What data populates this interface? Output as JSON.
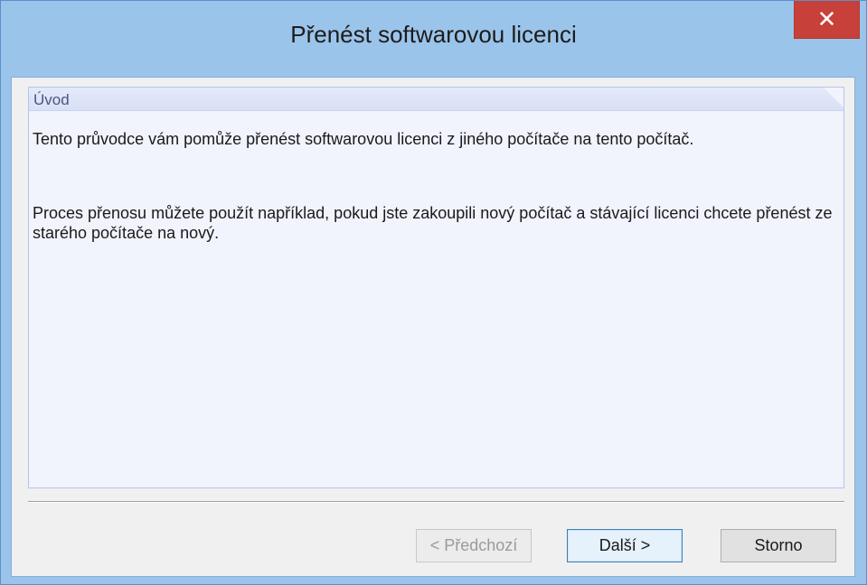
{
  "window": {
    "title": "Přenést softwarovou licenci",
    "close_glyph": "✕"
  },
  "panel": {
    "header": "Úvod",
    "paragraph1": "Tento průvodce vám pomůže přenést softwarovou licenci z jiného počítače na tento počítač.",
    "paragraph2": "Proces přenosu můžete použít například, pokud jste zakoupili nový počítač a stávající licenci chcete přenést ze starého počítače na nový."
  },
  "buttons": {
    "prev": "< Předchozí",
    "next": "Další >",
    "cancel": "Storno"
  },
  "colors": {
    "titlebar": "#9bc4ea",
    "close": "#c7403a",
    "panel_bg": "#f1f3fd"
  }
}
